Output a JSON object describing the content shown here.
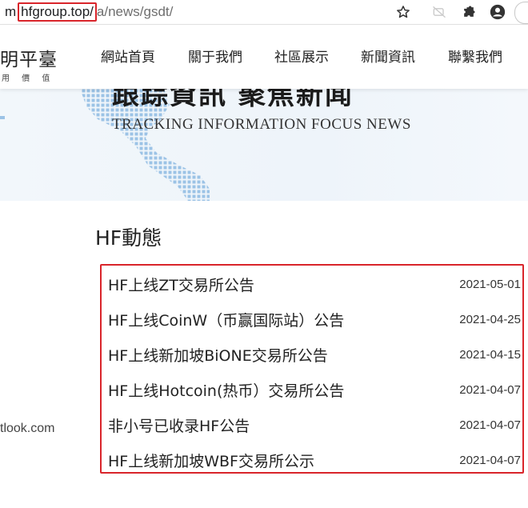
{
  "browser": {
    "url_prefix": "m",
    "url_host": "hfgroup.top/",
    "url_path": "a/news/gsdt/",
    "icons": [
      "star-icon",
      "extension-disabled-icon",
      "puzzle-icon",
      "profile-icon"
    ],
    "highlight_color": "#d9252b"
  },
  "site": {
    "logo_text": "明平臺",
    "logo_sub": "用 價 值",
    "nav": [
      "網站首頁",
      "關于我們",
      "社區展示",
      "新聞資訊",
      "聯繫我們"
    ]
  },
  "banner": {
    "title_cut": "跟踪資訊 聚焦新闻",
    "subtitle": "TRACKING INFORMATION FOCUS NEWS"
  },
  "section": {
    "title": "HF動態",
    "news": [
      {
        "title": "HF上线ZT交易所公告",
        "date": "2021-05-01"
      },
      {
        "title": "HF上线CoinW（币赢国际站）公告",
        "date": "2021-04-25"
      },
      {
        "title": "HF上线新加坡BiONE交易所公告",
        "date": "2021-04-15"
      },
      {
        "title": "HF上线Hotcoin(热币）交易所公告",
        "date": "2021-04-07"
      },
      {
        "title": "非小号已收录HF公告",
        "date": "2021-04-07"
      },
      {
        "title": "HF上线新加坡WBF交易所公示",
        "date": "2021-04-07"
      }
    ]
  },
  "sidebar": {
    "email_fragment": "tlook.com"
  }
}
